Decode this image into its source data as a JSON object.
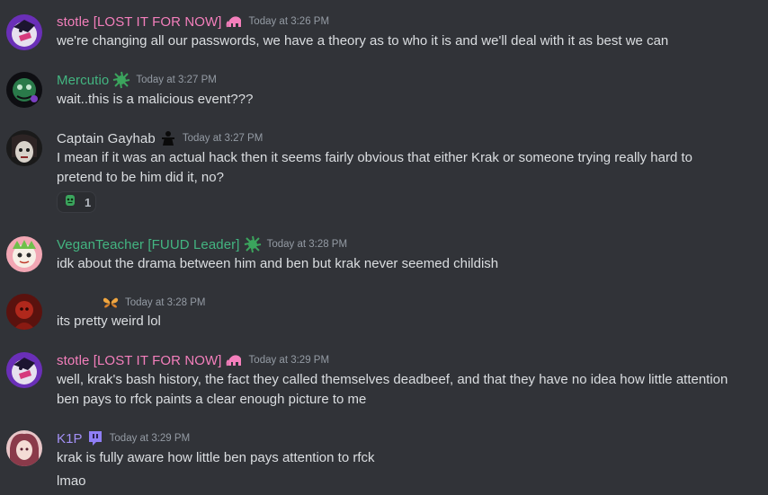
{
  "messages": [
    {
      "username": "stotle [LOST IT FOR NOW]",
      "name_color": "#f47fbc",
      "role_icon": "pink-elephant-icon",
      "timestamp": "Today at 3:26 PM",
      "lines": [
        "we're changing all our passwords, we have a theory as to who it is and we'll deal with it as best we can"
      ]
    },
    {
      "username": "Mercutio",
      "name_color": "#43b581",
      "role_icon": "green-splat-icon",
      "timestamp": "Today at 3:27 PM",
      "lines": [
        "wait..this is a malicious event???"
      ]
    },
    {
      "username": "Captain Gayhab",
      "name_color": "#dbdee1",
      "role_icon": "black-figure-icon",
      "timestamp": "Today at 3:27 PM",
      "lines": [
        "I mean if it was an actual hack then it seems fairly obvious that either Krak or someone trying really hard to",
        "pretend to be him did it, no?"
      ],
      "reaction": {
        "emoji": "green-face-emoji-icon",
        "count": "1"
      }
    },
    {
      "username": "VeganTeacher [FUUD Leader]",
      "name_color": "#43b581",
      "role_icon": "green-splat-icon",
      "timestamp": "Today at 3:28 PM",
      "lines": [
        "idk about the drama between him and ben but krak never seemed childish"
      ]
    },
    {
      "username": "",
      "name_color": "#dbdee1",
      "role_icon": "butterfly-icon",
      "timestamp": "Today at 3:28 PM",
      "lines": [
        "its pretty weird lol"
      ]
    },
    {
      "username": "stotle [LOST IT FOR NOW]",
      "name_color": "#f47fbc",
      "role_icon": "pink-elephant-icon",
      "timestamp": "Today at 3:29 PM",
      "lines": [
        "well, krak's bash history, the fact they called themselves deadbeef, and that they have no idea how little attention",
        "ben pays to rfck paints a clear enough picture to me"
      ]
    },
    {
      "username": "K1P",
      "name_color": "#a390f5",
      "role_icon": "purple-badge-icon",
      "timestamp": "Today at 3:29 PM",
      "lines": [
        "krak is fully aware how little ben pays attention to rfck",
        "lmao"
      ]
    }
  ]
}
